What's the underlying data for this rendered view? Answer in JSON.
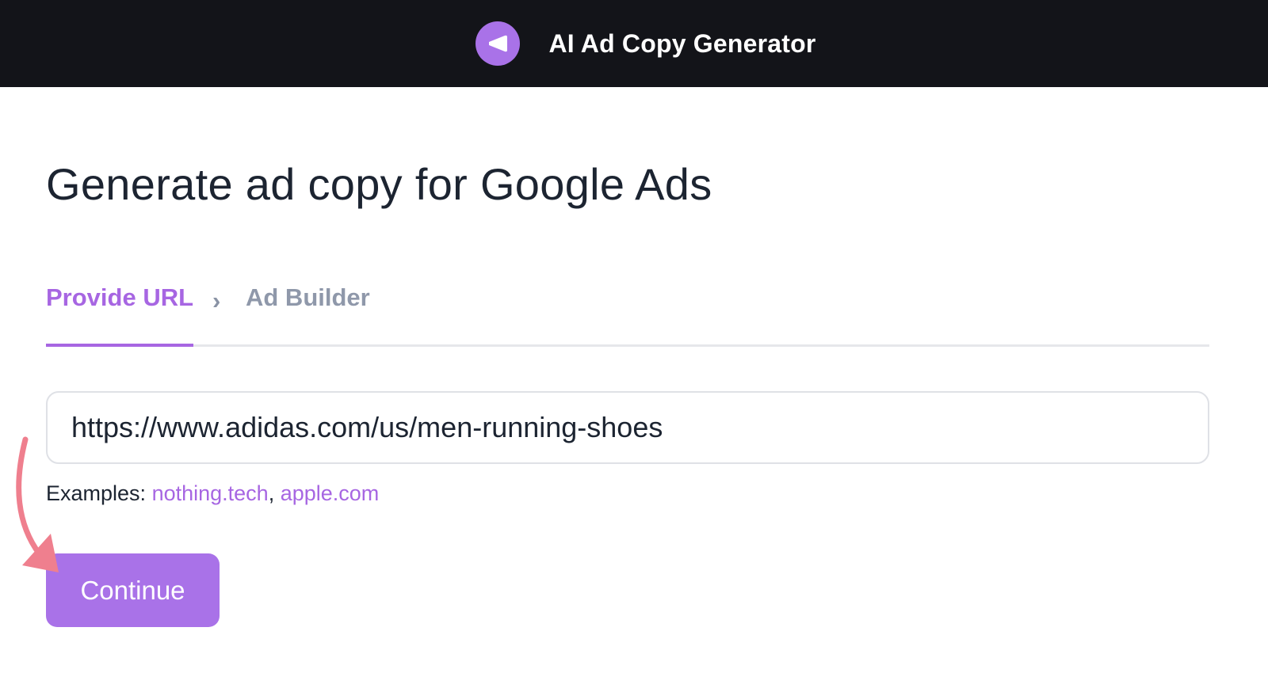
{
  "header": {
    "title": "AI Ad Copy Generator",
    "logo_icon": "megaphone-icon",
    "background_color": "#131419",
    "accent_color": "#a972e8"
  },
  "main": {
    "title": "Generate ad copy for Google Ads",
    "steps": [
      {
        "label": "Provide URL",
        "state": "active"
      },
      {
        "label": "Ad Builder",
        "state": "inactive"
      }
    ],
    "step_separator": "›",
    "url_input": {
      "value": "https://www.adidas.com/us/men-running-shoes"
    },
    "examples": {
      "prefix": "Examples: ",
      "links": [
        "nothing.tech",
        "apple.com"
      ],
      "separator": ", "
    },
    "continue_label": "Continue"
  },
  "annotation": {
    "icon": "curved-arrow-icon",
    "color": "#ef7f8e"
  }
}
